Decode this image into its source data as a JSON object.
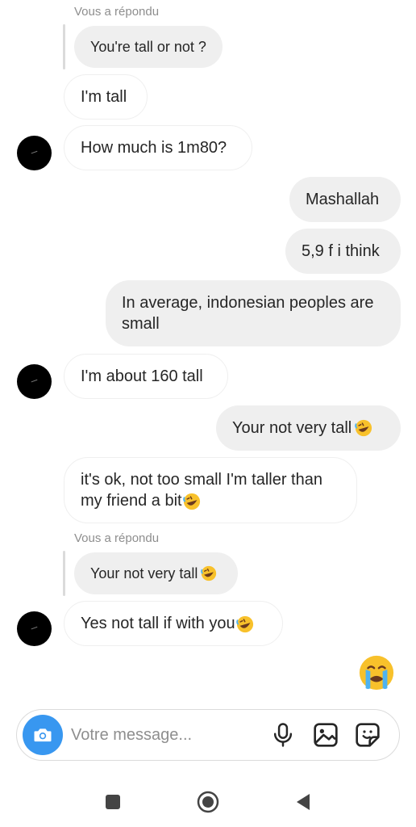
{
  "messages": {
    "reply_label_1": "Vous a répondu",
    "quote_1": "You're tall or not ?",
    "msg_im_tall": "I'm tall",
    "msg_how_much": "How much is 1m80?",
    "msg_mashallah": "Mashallah",
    "msg_59": "5,9 f i think",
    "msg_average": "In average, indonesian peoples are small",
    "msg_160": "I'm about 160 tall",
    "msg_not_very_tall": "Your not very tall",
    "msg_its_ok": "it's ok, not too small I'm taller than my friend a bit",
    "reply_label_2": "Vous a répondu",
    "quote_2": "Your not very tall",
    "msg_yes_not_tall": "Yes not tall if with you"
  },
  "composer": {
    "placeholder": "Votre message..."
  },
  "icons": {
    "camera": "camera-icon",
    "mic": "microphone-icon",
    "gallery": "gallery-icon",
    "sticker": "sticker-icon",
    "laughing": "rolling-on-floor-laughing-emoji",
    "crying": "loudly-crying-emoji",
    "nav_recents": "recents-square-icon",
    "nav_home": "home-circle-icon",
    "nav_back": "back-triangle-icon"
  },
  "colors": {
    "accent": "#3897f0",
    "bubble_gray": "#efefef",
    "text": "#262626",
    "muted": "#8e8e8e"
  }
}
